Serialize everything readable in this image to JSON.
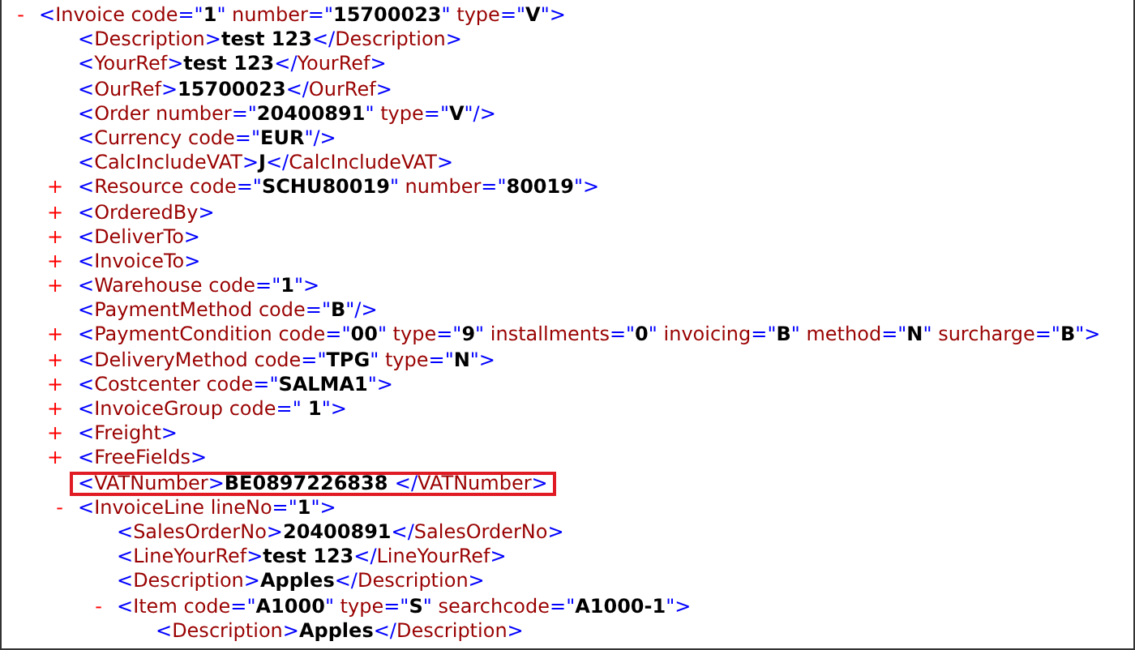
{
  "xml_tree": [
    {
      "toggle": "-",
      "markup": "<Invoice code=\"1\" number=\"15700023\" type=\"V\">",
      "highlighted": false,
      "children": [
        {
          "markup": "<Description>test 123</Description>",
          "highlighted": false
        },
        {
          "markup": "<YourRef>test 123</YourRef>",
          "highlighted": false
        },
        {
          "markup": "<OurRef>15700023</OurRef>",
          "highlighted": false
        },
        {
          "markup": "<Order number=\"20400891\" type=\"V\"/>",
          "highlighted": false
        },
        {
          "markup": "<Currency code=\"EUR\"/>",
          "highlighted": false
        },
        {
          "markup": "<CalcIncludeVAT>J</CalcIncludeVAT>",
          "highlighted": false
        },
        {
          "toggle": "+",
          "markup": "<Resource code=\"SCHU80019\" number=\"80019\">",
          "highlighted": false
        },
        {
          "toggle": "+",
          "markup": "<OrderedBy>",
          "highlighted": false
        },
        {
          "toggle": "+",
          "markup": "<DeliverTo>",
          "highlighted": false
        },
        {
          "toggle": "+",
          "markup": "<InvoiceTo>",
          "highlighted": false
        },
        {
          "toggle": "+",
          "markup": "<Warehouse code=\"1\">",
          "highlighted": false
        },
        {
          "markup": "<PaymentMethod code=\"B\"/>",
          "highlighted": false
        },
        {
          "toggle": "+",
          "markup": "<PaymentCondition code=\"00\" type=\"9\" installments=\"0\" invoicing=\"B\" method=\"N\" surcharge=\"B\">",
          "highlighted": false
        },
        {
          "toggle": "+",
          "markup": "<DeliveryMethod code=\"TPG\" type=\"N\">",
          "highlighted": false
        },
        {
          "toggle": "+",
          "markup": "<Costcenter code=\"SALMA1\">",
          "highlighted": false
        },
        {
          "toggle": "+",
          "markup": "<InvoiceGroup code=\" 1\">",
          "highlighted": false
        },
        {
          "toggle": "+",
          "markup": "<Freight>",
          "highlighted": false
        },
        {
          "toggle": "+",
          "markup": "<FreeFields>",
          "highlighted": false
        },
        {
          "markup": "<VATNumber>BE0897226838 </VATNumber>",
          "highlighted": true
        },
        {
          "toggle": "-",
          "markup": "<InvoiceLine lineNo=\"1\">",
          "highlighted": false,
          "children": [
            {
              "markup": "<SalesOrderNo>20400891</SalesOrderNo>",
              "highlighted": false
            },
            {
              "markup": "<LineYourRef>test 123</LineYourRef>",
              "highlighted": false
            },
            {
              "markup": "<Description>Apples</Description>",
              "highlighted": false
            },
            {
              "toggle": "-",
              "markup": "<Item code=\"A1000\" type=\"S\" searchcode=\"A1000-1\">",
              "highlighted": false,
              "children": [
                {
                  "markup": "<Description>Apples</Description>",
                  "highlighted": false
                }
              ]
            }
          ]
        }
      ]
    }
  ]
}
